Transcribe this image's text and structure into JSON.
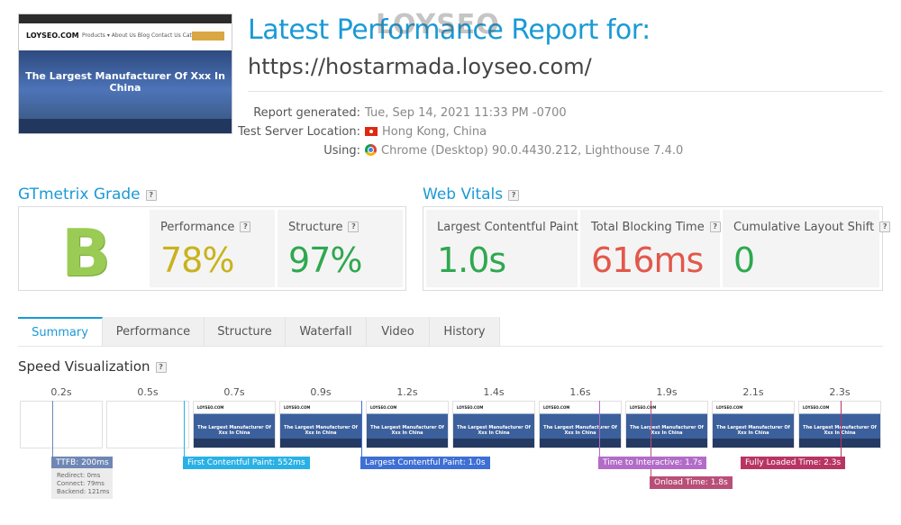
{
  "header": {
    "title": "Latest Performance Report for:",
    "watermark": "LOYSEO",
    "url": "https://hostarmada.loyseo.com/",
    "thumbnail": {
      "logo": "LOYSEO.COM",
      "nav": "Products ▾  About Us  Blog  Contact Us  Catalogs",
      "headline": "The Largest Manufacturer Of Xxx In China"
    }
  },
  "meta": {
    "report_generated_label": "Report generated:",
    "report_generated_value": "Tue, Sep 14, 2021 11:33 PM -0700",
    "server_label": "Test Server Location:",
    "server_value": "Hong Kong, China",
    "using_label": "Using:",
    "using_value": "Chrome (Desktop) 90.0.4430.212, Lighthouse 7.4.0"
  },
  "grade": {
    "heading": "GTmetrix Grade",
    "help": "?",
    "letter": "B",
    "performance_label": "Performance",
    "performance_value": "78%",
    "structure_label": "Structure",
    "structure_value": "97%"
  },
  "vitals": {
    "heading": "Web Vitals",
    "help": "?",
    "lcp_label": "Largest Contentful Paint",
    "lcp_value": "1.0s",
    "tbt_label": "Total Blocking Time",
    "tbt_value": "616ms",
    "cls_label": "Cumulative Layout Shift",
    "cls_value": "0"
  },
  "tabs": [
    "Summary",
    "Performance",
    "Structure",
    "Waterfall",
    "Video",
    "History"
  ],
  "speed": {
    "heading": "Speed Visualization",
    "help": "?",
    "times": [
      "0.2s",
      "0.5s",
      "0.7s",
      "0.9s",
      "1.2s",
      "1.4s",
      "1.6s",
      "1.9s",
      "2.1s",
      "2.3s"
    ],
    "frame_headline": "The Largest Manufacturer Of Xxx In China",
    "frame_logo": "LOYSEO.COM",
    "markers": {
      "ttfb": "TTFB: 200ms",
      "fcp": "First Contentful Paint: 552ms",
      "lcp": "Largest Contentful Paint: 1.0s",
      "tti": "Time to Interactive: 1.7s",
      "onload": "Onload Time: 1.8s",
      "fully_loaded": "Fully Loaded Time: 2.3s"
    },
    "ttfb_detail": {
      "redirect": "Redirect: 0ms",
      "connect": "Connect: 79ms",
      "backend": "Backend: 121ms"
    }
  },
  "colors": {
    "accent": "#1a9ad6",
    "grade_b": "#9acb54",
    "performance": "#c9b21d",
    "good": "#2fa84f",
    "bad": "#e2584b",
    "ttfb": "#6f87b5",
    "fcp": "#29b1e6",
    "lcp": "#3e6fd4",
    "tti": "#b26cc8",
    "onload": "#b84f78",
    "fully_loaded": "#b83563"
  }
}
